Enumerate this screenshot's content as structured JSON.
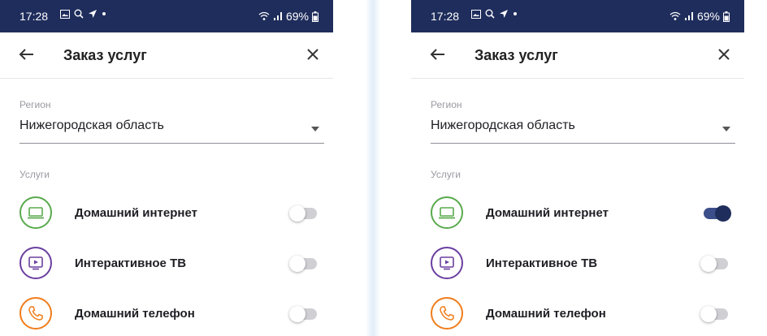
{
  "status_bar": {
    "time": "17:28",
    "battery": "69%"
  },
  "header": {
    "title": "Заказ услуг"
  },
  "region": {
    "label": "Регион",
    "value": "Нижегородская область"
  },
  "services": {
    "label": "Услуги",
    "items": [
      {
        "name": "Домашний интернет",
        "icon": "laptop-icon",
        "color": "#5aaa4e"
      },
      {
        "name": "Интерактивное ТВ",
        "icon": "tv-icon",
        "color": "#6b3fa0"
      },
      {
        "name": "Домашний телефон",
        "icon": "phone-icon",
        "color": "#f07d1c"
      }
    ]
  },
  "screens": {
    "left": {
      "toggles": [
        "off",
        "off",
        "off"
      ]
    },
    "right": {
      "toggles": [
        "on",
        "off",
        "off"
      ]
    }
  },
  "colors": {
    "status_bar": "#1f2d5c",
    "toggle_on": "#1f2d5c"
  }
}
